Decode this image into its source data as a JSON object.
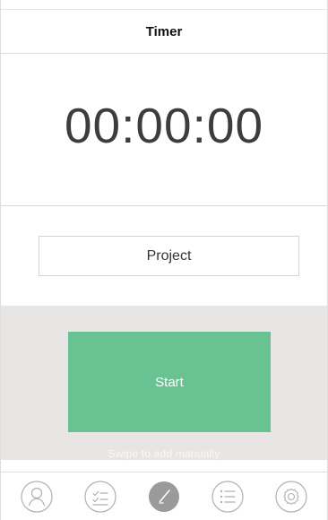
{
  "header": {
    "title": "Timer"
  },
  "timer": {
    "display": "00:00:00"
  },
  "project": {
    "label": "Project"
  },
  "actions": {
    "start_label": "Start",
    "swipe_hint": "Swipe to add manually"
  },
  "bottom_nav": {
    "items": [
      {
        "icon": "profile-icon",
        "active": false
      },
      {
        "icon": "checklist-icon",
        "active": false
      },
      {
        "icon": "timer-icon",
        "active": true
      },
      {
        "icon": "list-icon",
        "active": false
      },
      {
        "icon": "settings-icon",
        "active": false
      }
    ]
  },
  "colors": {
    "accent_green": "#68c292",
    "action_background": "#e7e6e4",
    "active_nav": "#9a9a9a"
  }
}
